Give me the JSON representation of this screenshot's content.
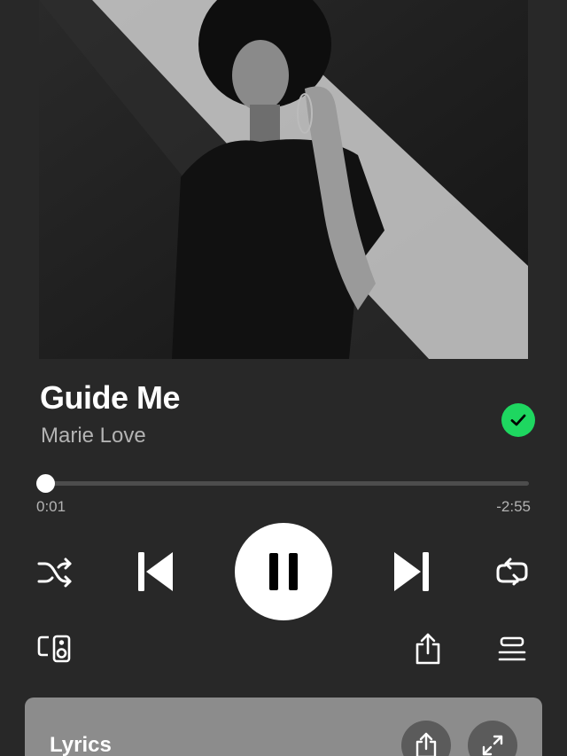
{
  "now_playing": {
    "title": "Guide Me",
    "artist": "Marie Love",
    "liked": true,
    "album_art": "black-and-white-portrait"
  },
  "playback": {
    "elapsed": "0:01",
    "remaining": "-2:55",
    "progress_fraction": 0.006,
    "state": "playing"
  },
  "controls": {
    "shuffle_icon": "shuffle-icon",
    "previous_icon": "skip-previous-icon",
    "pause_icon": "pause-icon",
    "next_icon": "skip-next-icon",
    "repeat_icon": "repeat-icon",
    "devices_icon": "devices-icon",
    "share_icon": "share-icon",
    "queue_icon": "queue-icon"
  },
  "lyrics": {
    "title": "Lyrics",
    "share_icon": "share-icon",
    "expand_icon": "expand-icon"
  },
  "colors": {
    "background": "#282828",
    "accent": "#1ed760",
    "secondary_text": "#b3b3b3",
    "lyrics_card": "#8c8c8c"
  }
}
